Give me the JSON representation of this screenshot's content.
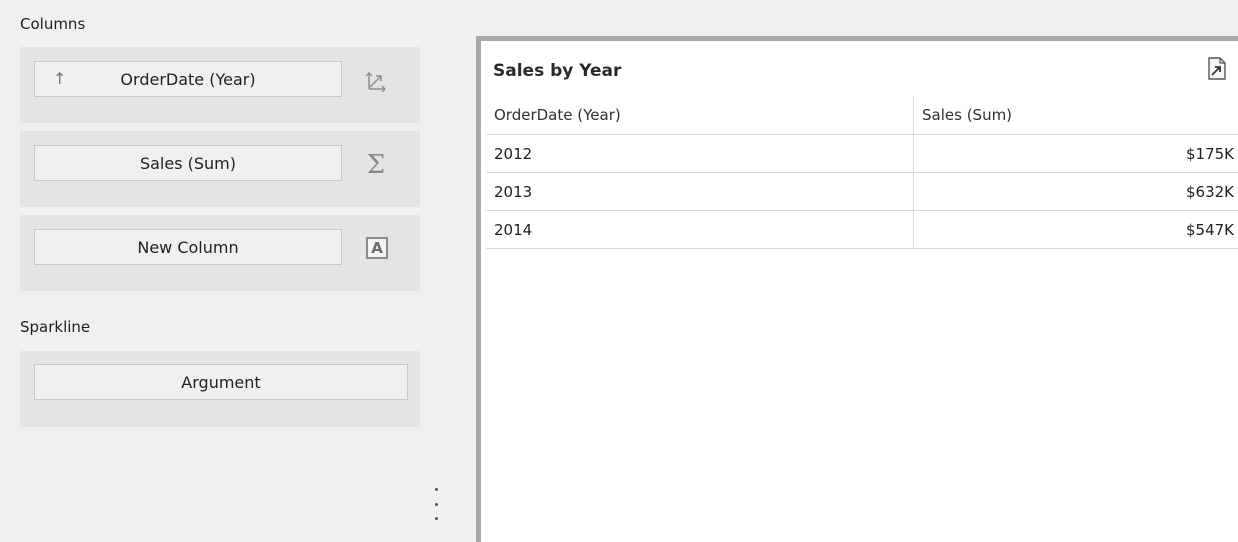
{
  "left_panel": {
    "columns_label": "Columns",
    "columns": [
      {
        "label": "OrderDate (Year)",
        "sort_icon": "arrow-up-icon",
        "type_icon": "dimension-axis-icon"
      },
      {
        "label": "Sales (Sum)",
        "type_icon": "sigma-icon"
      },
      {
        "label": "New Column",
        "type_icon": "text-type-icon",
        "type_glyph": "A"
      }
    ],
    "sparkline_label": "Sparkline",
    "sparkline": {
      "label": "Argument"
    }
  },
  "preview": {
    "title": "Sales by Year",
    "export_icon": "export-icon",
    "headers": [
      "OrderDate (Year)",
      "Sales (Sum)"
    ],
    "rows": [
      {
        "year": "2012",
        "sales": "$175K"
      },
      {
        "year": "2013",
        "sales": "$632K"
      },
      {
        "year": "2014",
        "sales": "$547K"
      }
    ]
  },
  "colors": {
    "panel_bg": "#f0f0f0",
    "row_bg": "#e4e4e4",
    "frame_border": "#a9a9a9",
    "grid_line": "#d8d8d8"
  }
}
